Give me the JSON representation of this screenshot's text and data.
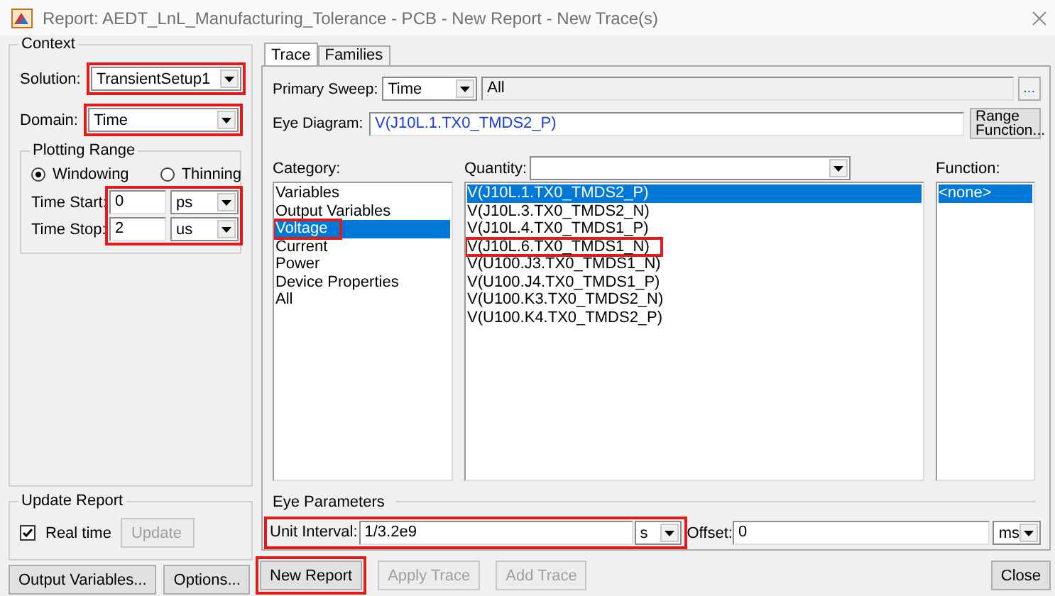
{
  "window": {
    "title": "Report: AEDT_LnL_Manufacturing_Tolerance - PCB - New Report - New Trace(s)"
  },
  "context": {
    "title": "Context",
    "solution": {
      "label": "Solution:",
      "value": "TransientSetup1",
      "highlighted": true
    },
    "domain": {
      "label": "Domain:",
      "value": "Time",
      "highlighted": true
    },
    "plotting_range": {
      "title": "Plotting Range",
      "highlighted": true,
      "modes": [
        {
          "label": "Windowing",
          "selected": true
        },
        {
          "label": "Thinning",
          "selected": false
        }
      ],
      "time_start": {
        "label": "Time Start:",
        "value": "0",
        "unit": "ps"
      },
      "time_stop": {
        "label": "Time Stop:",
        "value": "2",
        "unit": "us"
      }
    }
  },
  "update_report": {
    "title": "Update Report",
    "real_time": {
      "label": "Real time",
      "checked": true
    },
    "update_button": {
      "label": "Update",
      "disabled": true
    }
  },
  "left_buttons": [
    {
      "label": "Output Variables..."
    },
    {
      "label": "Options..."
    }
  ],
  "tabs": [
    {
      "label": "Trace",
      "selected": true
    },
    {
      "label": "Families",
      "selected": false
    }
  ],
  "primary_sweep": {
    "label": "Primary Sweep:",
    "value": "Time",
    "range": "All",
    "more_button": "..."
  },
  "eye_diagram": {
    "label": "Eye Diagram:",
    "value": "V(J10L.1.TX0_TMDS2_P)",
    "range_button": "Range Function..."
  },
  "category": {
    "label": "Category:",
    "items": [
      {
        "label": "Variables",
        "selected": false,
        "highlighted": false
      },
      {
        "label": "Output Variables",
        "selected": false,
        "highlighted": false
      },
      {
        "label": "Voltage",
        "selected": true,
        "highlighted": true
      },
      {
        "label": "Current",
        "selected": false,
        "highlighted": false
      },
      {
        "label": "Power",
        "selected": false,
        "highlighted": false
      },
      {
        "label": "Device Properties",
        "selected": false,
        "highlighted": false
      },
      {
        "label": "All",
        "selected": false,
        "highlighted": false
      }
    ]
  },
  "quantity": {
    "label": "Quantity:",
    "items": [
      {
        "label": "V(J10L.1.TX0_TMDS2_P)",
        "selected": true,
        "highlighted": false
      },
      {
        "label": "V(J10L.3.TX0_TMDS2_N)",
        "selected": false,
        "highlighted": false
      },
      {
        "label": "V(J10L.4.TX0_TMDS1_P)",
        "selected": false,
        "highlighted": false
      },
      {
        "label": "V(J10L.6.TX0_TMDS1_N)",
        "selected": false,
        "highlighted": true
      },
      {
        "label": "V(U100.J3.TX0_TMDS1_N)",
        "selected": false,
        "highlighted": false
      },
      {
        "label": "V(U100.J4.TX0_TMDS1_P)",
        "selected": false,
        "highlighted": false
      },
      {
        "label": "V(U100.K3.TX0_TMDS2_N)",
        "selected": false,
        "highlighted": false
      },
      {
        "label": "V(U100.K4.TX0_TMDS2_P)",
        "selected": false,
        "highlighted": false
      }
    ]
  },
  "function": {
    "label": "Function:",
    "items": [
      {
        "label": "<none>",
        "selected": true,
        "highlighted": false
      }
    ]
  },
  "eye_parameters": {
    "title": "Eye Parameters",
    "unit_interval": {
      "label": "Unit Interval:",
      "value": "1/3.2e9",
      "unit": "s",
      "highlighted": true
    },
    "offset": {
      "label": "Offset:",
      "value": "0",
      "unit": "ms"
    }
  },
  "bottom_buttons": [
    {
      "label": "New Report",
      "disabled": false,
      "highlighted": true
    },
    {
      "label": "Apply Trace",
      "disabled": true,
      "highlighted": false
    },
    {
      "label": "Add Trace",
      "disabled": true,
      "highlighted": false
    }
  ],
  "close_button": {
    "label": "Close"
  }
}
